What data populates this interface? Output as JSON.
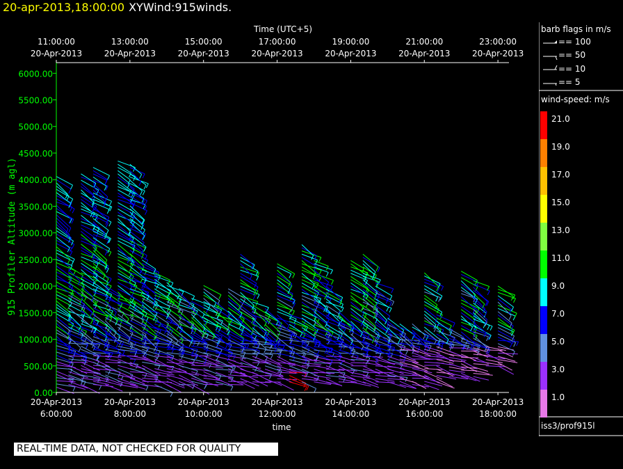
{
  "header": {
    "date": "20-apr-2013,18:00:00",
    "product": "XYWind:915winds."
  },
  "chart_data": {
    "type": "wind-barb time-height plot",
    "top_axis": {
      "title": "Time (UTC+5)",
      "ticks": [
        {
          "time": "11:00:00",
          "date": "20-Apr-2013"
        },
        {
          "time": "13:00:00",
          "date": "20-Apr-2013"
        },
        {
          "time": "15:00:00",
          "date": "20-Apr-2013"
        },
        {
          "time": "17:00:00",
          "date": "20-Apr-2013"
        },
        {
          "time": "19:00:00",
          "date": "20-Apr-2013"
        },
        {
          "time": "21:00:00",
          "date": "20-Apr-2013"
        },
        {
          "time": "23:00:00",
          "date": "20-Apr-2013"
        }
      ]
    },
    "bottom_axis": {
      "title": "time",
      "ticks": [
        {
          "date": "20-Apr-2013",
          "time": "6:00:00"
        },
        {
          "date": "20-Apr-2013",
          "time": "8:00:00"
        },
        {
          "date": "20-Apr-2013",
          "time": "10:00:00"
        },
        {
          "date": "20-Apr-2013",
          "time": "12:00:00"
        },
        {
          "date": "20-Apr-2013",
          "time": "14:00:00"
        },
        {
          "date": "20-Apr-2013",
          "time": "16:00:00"
        },
        {
          "date": "20-Apr-2013",
          "time": "18:00:00"
        }
      ],
      "range_hours": [
        6.0,
        18.3
      ]
    },
    "y_axis": {
      "title": "915 Profiler Altitude (m agl)",
      "ticks": [
        "0.00",
        "500.00",
        "1000.00",
        "1500.00",
        "2000.00",
        "2500.00",
        "3000.00",
        "3500.00",
        "4000.00",
        "4500.00",
        "5000.00",
        "5500.00",
        "6000.00"
      ],
      "ylim": [
        0,
        6200
      ]
    },
    "profiles": [
      {
        "hour": 6.0,
        "low": 100,
        "high": 4100
      },
      {
        "hour": 6.33,
        "low": 150,
        "high": 2400
      },
      {
        "hour": 6.67,
        "low": 150,
        "high": 4150
      },
      {
        "hour": 7.0,
        "low": 150,
        "high": 4250
      },
      {
        "hour": 7.33,
        "low": 150,
        "high": 2050
      },
      {
        "hour": 7.67,
        "low": 150,
        "high": 4350
      },
      {
        "hour": 8.0,
        "low": 150,
        "high": 4300
      },
      {
        "hour": 8.33,
        "low": 150,
        "high": 2500
      },
      {
        "hour": 8.67,
        "low": 150,
        "high": 2250
      },
      {
        "hour": 9.0,
        "low": 150,
        "high": 2100
      },
      {
        "hour": 9.33,
        "low": 150,
        "high": 2000
      },
      {
        "hour": 9.67,
        "low": 150,
        "high": 1800
      },
      {
        "hour": 10.0,
        "low": 150,
        "high": 2050
      },
      {
        "hour": 10.33,
        "low": 200,
        "high": 1700
      },
      {
        "hour": 10.67,
        "low": 150,
        "high": 1950
      },
      {
        "hour": 11.0,
        "low": 200,
        "high": 2600
      },
      {
        "hour": 11.33,
        "low": 200,
        "high": 1700
      },
      {
        "hour": 11.67,
        "low": 200,
        "high": 1600
      },
      {
        "hour": 12.0,
        "low": 200,
        "high": 2450
      },
      {
        "hour": 12.33,
        "low": 200,
        "high": 1500
      },
      {
        "hour": 12.67,
        "low": 200,
        "high": 2800
      },
      {
        "hour": 13.0,
        "low": 200,
        "high": 2500
      },
      {
        "hour": 13.33,
        "low": 200,
        "high": 2050
      },
      {
        "hour": 13.67,
        "low": 200,
        "high": 1550
      },
      {
        "hour": 14.0,
        "low": 200,
        "high": 2500
      },
      {
        "hour": 14.33,
        "low": 200,
        "high": 2600
      },
      {
        "hour": 14.67,
        "low": 200,
        "high": 2100
      },
      {
        "hour": 15.0,
        "low": 200,
        "high": 1400
      },
      {
        "hour": 15.33,
        "low": 150,
        "high": 1300
      },
      {
        "hour": 15.67,
        "low": 150,
        "high": 1300
      },
      {
        "hour": 16.0,
        "low": 150,
        "high": 2250
      },
      {
        "hour": 16.33,
        "low": 200,
        "high": 1500
      },
      {
        "hour": 16.67,
        "low": 300,
        "high": 1200
      },
      {
        "hour": 17.0,
        "low": 300,
        "high": 2300
      },
      {
        "hour": 17.33,
        "low": 300,
        "high": 2100
      },
      {
        "hour": 17.67,
        "low": 500,
        "high": 900
      },
      {
        "hour": 18.0,
        "low": 500,
        "high": 2000
      }
    ]
  },
  "legend": {
    "barb_title": "barb flags in m/s",
    "barbs": [
      {
        "label": "== 100"
      },
      {
        "label": "== 50"
      },
      {
        "label": "== 10"
      },
      {
        "label": "== 5"
      }
    ],
    "speed_title": "wind-speed: m/s",
    "scale": [
      {
        "label": "21.0",
        "color": "#ff0000"
      },
      {
        "label": "19.0",
        "color": "#ff8000"
      },
      {
        "label": "17.0",
        "color": "#ffc000"
      },
      {
        "label": "15.0",
        "color": "#ffff00"
      },
      {
        "label": "13.0",
        "color": "#80ff40"
      },
      {
        "label": "11.0",
        "color": "#00ff00"
      },
      {
        "label": "9.0",
        "color": "#00ffff"
      },
      {
        "label": "7.0",
        "color": "#0000ff"
      },
      {
        "label": "5.0",
        "color": "#6090e0"
      },
      {
        "label": "3.0",
        "color": "#9b30ff"
      },
      {
        "label": "1.0",
        "color": "#e878e8"
      }
    ],
    "source": "iss3/prof915l"
  },
  "footer": {
    "banner": "REAL-TIME DATA, NOT CHECKED FOR QUALITY"
  },
  "colors": {
    "axis_left": "#00ff00",
    "axis_other": "#ffffff",
    "title_date": "#ffff00"
  }
}
